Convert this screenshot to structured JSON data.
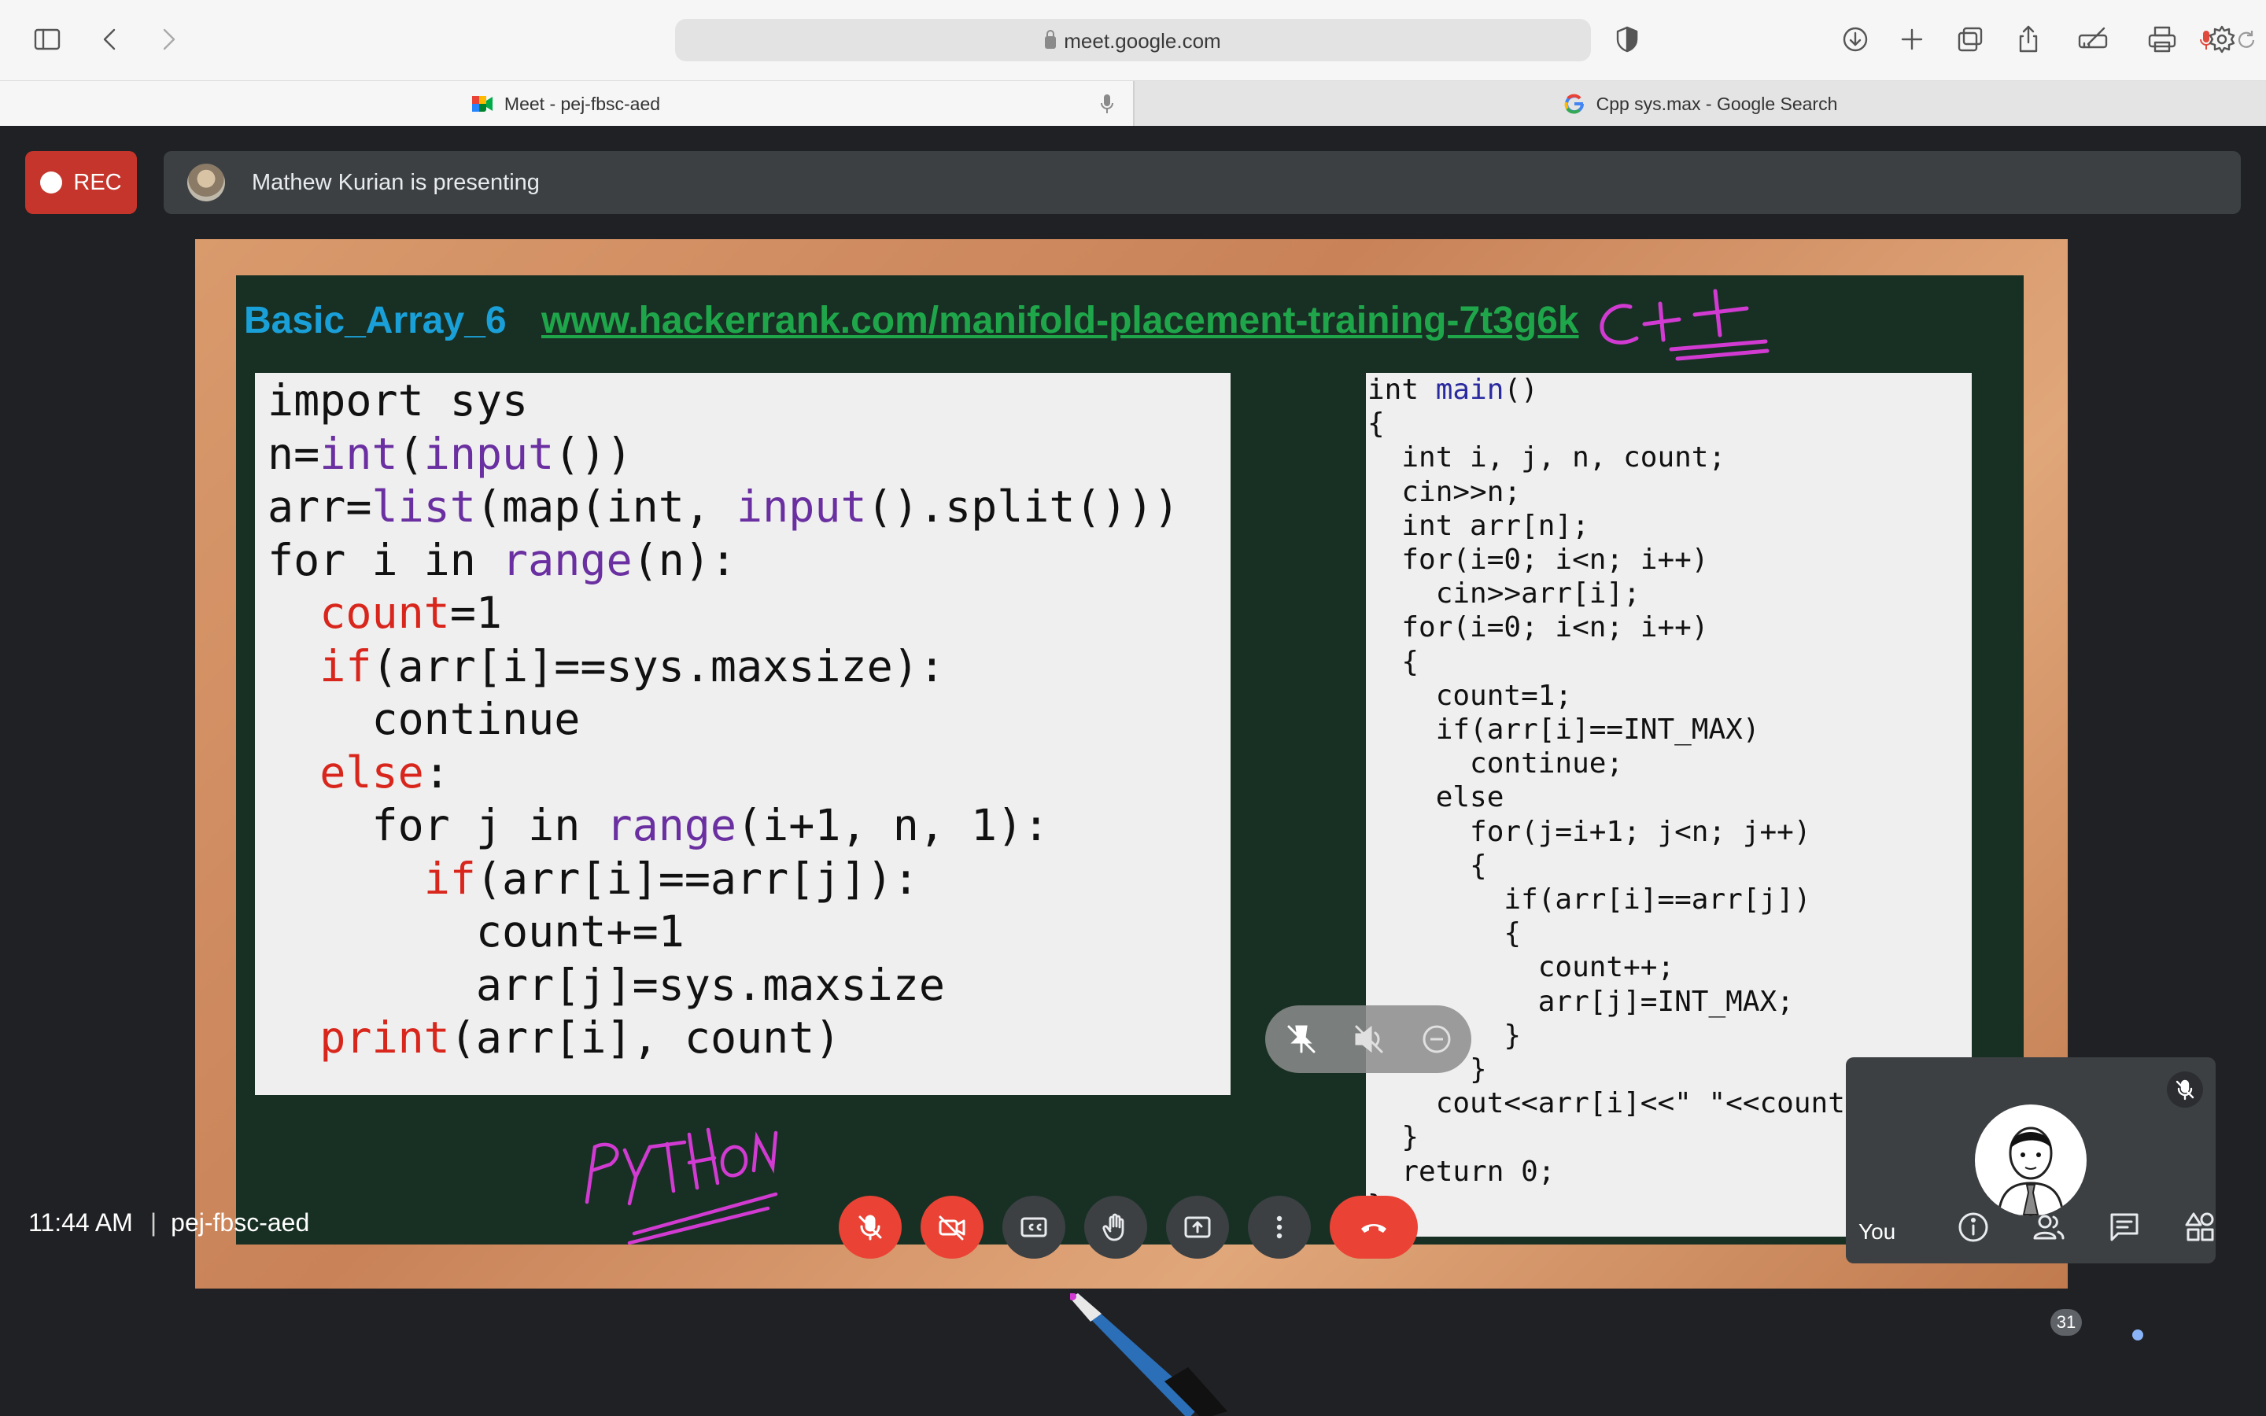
{
  "browser": {
    "address": "meet.google.com",
    "tabs": [
      {
        "label": "Meet - pej-fbsc-aed"
      },
      {
        "label": "Cpp sys.max - Google Search"
      }
    ]
  },
  "meet": {
    "recording_label": "REC",
    "presenting_text": "Mathew Kurian is presenting",
    "self_name": "You",
    "time": "11:44 AM",
    "meeting_code": "pej-fbsc-aed",
    "participant_count": "31"
  },
  "slide": {
    "title": "Basic_Array_6",
    "link": "www.hackerrank.com/manifold-placement-training-7t3g6k",
    "python_lines": [
      "import sys",
      "n=int(input())",
      "arr=list(map(int, input().split()))",
      "for i in range(n):",
      "  count=1",
      "  if(arr[i]==sys.maxsize):",
      "    continue",
      "  else:",
      "    for j in range(i+1, n, 1):",
      "      if(arr[i]==arr[j]):",
      "        count+=1",
      "        arr[j]=sys.maxsize",
      "  print(arr[i], count)"
    ],
    "cpp_lines": [
      "int main()",
      "{",
      "  int i, j, n, count;",
      "  cin>>n;",
      "  int arr[n];",
      "  for(i=0; i<n; i++)",
      "    cin>>arr[i];",
      "  for(i=0; i<n; i++)",
      "  {",
      "    count=1;",
      "    if(arr[i]==INT_MAX)",
      "      continue;",
      "    else",
      "      for(j=i+1; j<n; j++)",
      "      {",
      "        if(arr[i]==arr[j])",
      "        {",
      "          count++;",
      "          arr[j]=INT_MAX;",
      "        }",
      "      }",
      "    cout<<arr[i]<<\" \"<<count",
      "  }",
      "  return 0;",
      "}"
    ]
  },
  "colors": {
    "rec_red": "#c5352b",
    "control_red": "#ea4335",
    "board_green": "#183024",
    "python_keyword_red": "#d9261c",
    "python_builtin_purple": "#6a2fa0",
    "ink_magenta": "#d23bd2",
    "link_green": "#1fa64a",
    "title_blue": "#1aa0d8"
  },
  "icons": {
    "toolbar": [
      "sidebar-icon",
      "back-icon",
      "forward-icon",
      "shield-icon",
      "download-icon",
      "new-tab-icon",
      "tabs-overview-icon",
      "share-icon",
      "draw-icon",
      "print-icon",
      "settings-icon"
    ],
    "controls": [
      "mic-off-icon",
      "camera-off-icon",
      "captions-icon",
      "raise-hand-icon",
      "present-icon",
      "more-options-icon",
      "leave-call-icon"
    ],
    "right": [
      "info-icon",
      "people-icon",
      "chat-icon",
      "activities-icon"
    ]
  }
}
